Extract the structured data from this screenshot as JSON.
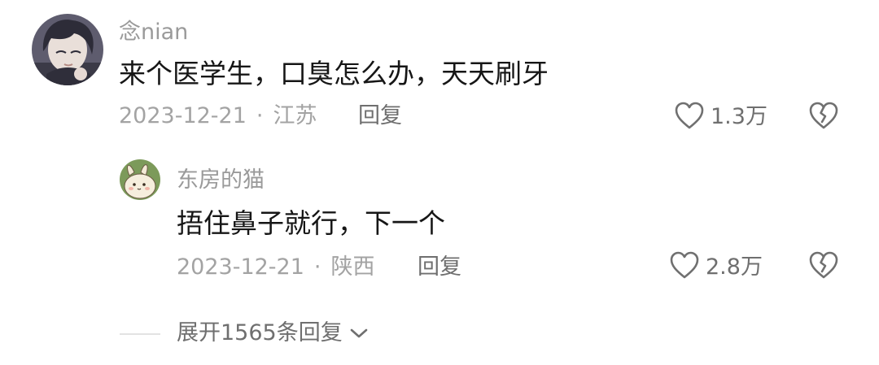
{
  "comment": {
    "username": "念nian",
    "text": "来个医学生，口臭怎么办，天天刷牙",
    "date": "2023-12-21",
    "separator": "·",
    "location": "江苏",
    "reply_label": "回复",
    "like_count": "1.3万",
    "avatar_icon": "anime-boy-avatar",
    "like_icon": "heart-outline-icon",
    "dislike_icon": "broken-heart-icon"
  },
  "reply": {
    "username": "东房的猫",
    "text": "捂住鼻子就行，下一个",
    "date": "2023-12-21",
    "separator": "·",
    "location": "陕西",
    "reply_label": "回复",
    "like_count": "2.8万",
    "avatar_icon": "cartoon-rabbit-avatar",
    "like_icon": "heart-outline-icon",
    "dislike_icon": "broken-heart-icon"
  },
  "expand": {
    "label": "展开1565条回复",
    "icon": "chevron-down-icon"
  },
  "colors": {
    "text_primary": "#161616",
    "text_secondary": "#9a9a9a",
    "text_action": "#6f6f6f",
    "background": "#ffffff"
  }
}
